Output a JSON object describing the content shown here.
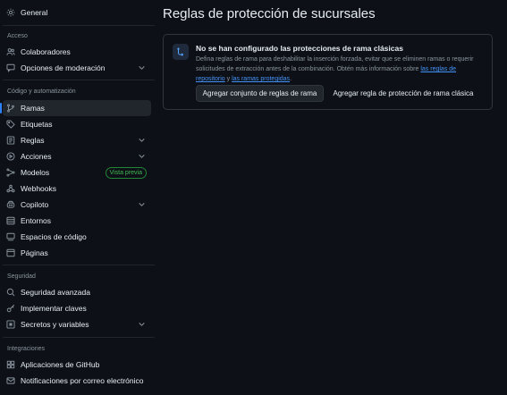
{
  "sidebar": {
    "general": "General",
    "sections": {
      "access": "Acceso",
      "code": "Código y automatización",
      "security": "Seguridad",
      "integrations": "Integraciones"
    },
    "items": {
      "collaborators": "Colaboradores",
      "moderation": "Opciones de moderación",
      "branches": "Ramas",
      "tags": "Etiquetas",
      "rules": "Reglas",
      "actions": "Acciones",
      "models": "Modelos",
      "models_badge": "Vista previa",
      "webhooks": "Webhooks",
      "copilot": "Copiloto",
      "environments": "Entornos",
      "codespaces": "Espacios de código",
      "pages": "Páginas",
      "advanced_security": "Seguridad avanzada",
      "deploy_keys": "Implementar claves",
      "secrets": "Secretos y variables",
      "github_apps": "Aplicaciones de GitHub",
      "email_notifications": "Notificaciones por correo electrónico"
    }
  },
  "main": {
    "title": "Reglas de protección de sucursales",
    "empty": {
      "title": "No se han configurado las protecciones de rama clásicas",
      "desc_part1": "Defina reglas de rama para deshabilitar la inserción forzada, evitar que se eliminen ramas o requerir solicitudes de extracción antes de la combinación. Obtén más información sobre ",
      "link1": "las reglas de repositorio",
      "desc_part2": " y ",
      "link2": "las ramas protegidas",
      "desc_part3": ".",
      "primary_button": "Agregar conjunto de reglas de rama",
      "secondary_button": "Agregar regla de protección de rama clásica"
    }
  },
  "colors": {
    "background": "#0d1117",
    "accent": "#2f81f7",
    "badge_green": "#3fb950"
  }
}
